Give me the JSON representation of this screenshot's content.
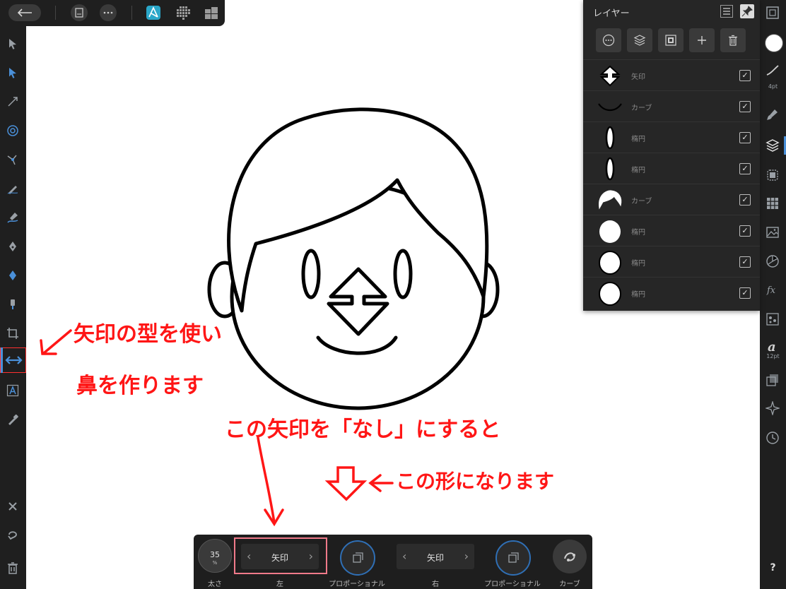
{
  "top_bar": {
    "back": "back",
    "doc": "document",
    "more": "more",
    "persona_designer": "designer",
    "persona_pixel": "pixel",
    "persona_export": "export"
  },
  "layers_panel": {
    "title": "レイヤー",
    "buttons": [
      "ellipsis",
      "layer-stack",
      "mask",
      "add",
      "delete"
    ],
    "layers": [
      {
        "name": "矢印",
        "thumb": "arrow",
        "checked": true
      },
      {
        "name": "カーブ",
        "thumb": "curve",
        "checked": true
      },
      {
        "name": "楕円",
        "thumb": "small-ellipse",
        "checked": true
      },
      {
        "name": "楕円",
        "thumb": "small-ellipse",
        "checked": true
      },
      {
        "name": "カーブ",
        "thumb": "hair",
        "checked": true
      },
      {
        "name": "楕円",
        "thumb": "ellipse",
        "checked": true
      },
      {
        "name": "楕円",
        "thumb": "ellipse",
        "checked": true
      },
      {
        "name": "楕円",
        "thumb": "ellipse",
        "checked": true
      }
    ]
  },
  "right_studio": {
    "stroke_size": "4pt",
    "font_size": "12pt",
    "help": "?"
  },
  "context_bar": {
    "width_value": "35",
    "width_unit": "%",
    "width_label": "太さ",
    "left_value": "矢印",
    "left_label": "左",
    "left_prop_label": "プロポーショナル",
    "right_value": "矢印",
    "right_label": "右",
    "right_prop_label": "プロポーショナル",
    "curve_label": "カーブ"
  },
  "annotations": {
    "line1": "矢印の型を使い",
    "line2": "鼻を作ります",
    "line3": "この矢印を「なし」にすると",
    "line4": "この形になります"
  },
  "colors": {
    "annotation": "#ff1616",
    "accent": "#2f6fb5",
    "toolbar": "#1f1f1f"
  }
}
